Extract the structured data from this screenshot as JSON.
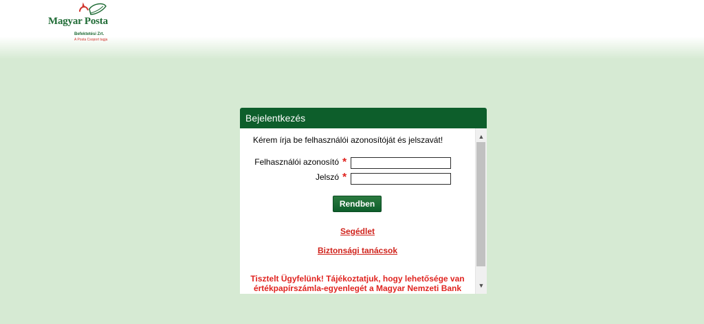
{
  "brand": {
    "name": "Magyar Posta",
    "subtitle": "Befektetési Zrt.",
    "tagline": "A Posta Csoport tagja",
    "color_primary": "#0d5e2b",
    "color_alert": "#e0231f",
    "color_background": "#d6ead3"
  },
  "login": {
    "title": "Bejelentkezés",
    "intro": "Kérem írja be felhasználói azonosítóját és jelszavát!",
    "username_label": "Felhasználói azonosító",
    "username_value": "",
    "password_label": "Jelszó",
    "password_value": "",
    "required_marker": "*",
    "submit_label": "Rendben",
    "help_link": "Segédlet",
    "security_link": "Biztonsági tanácsok",
    "notice": "Tisztelt Ügyfelünk! Tájékoztatjuk, hogy lehetősége van értékpapírszámla-egyenlegét a Magyar Nemzeti Bank"
  },
  "scrollbar": {
    "up_icon": "arrow-up-icon",
    "down_icon": "arrow-down-icon"
  }
}
